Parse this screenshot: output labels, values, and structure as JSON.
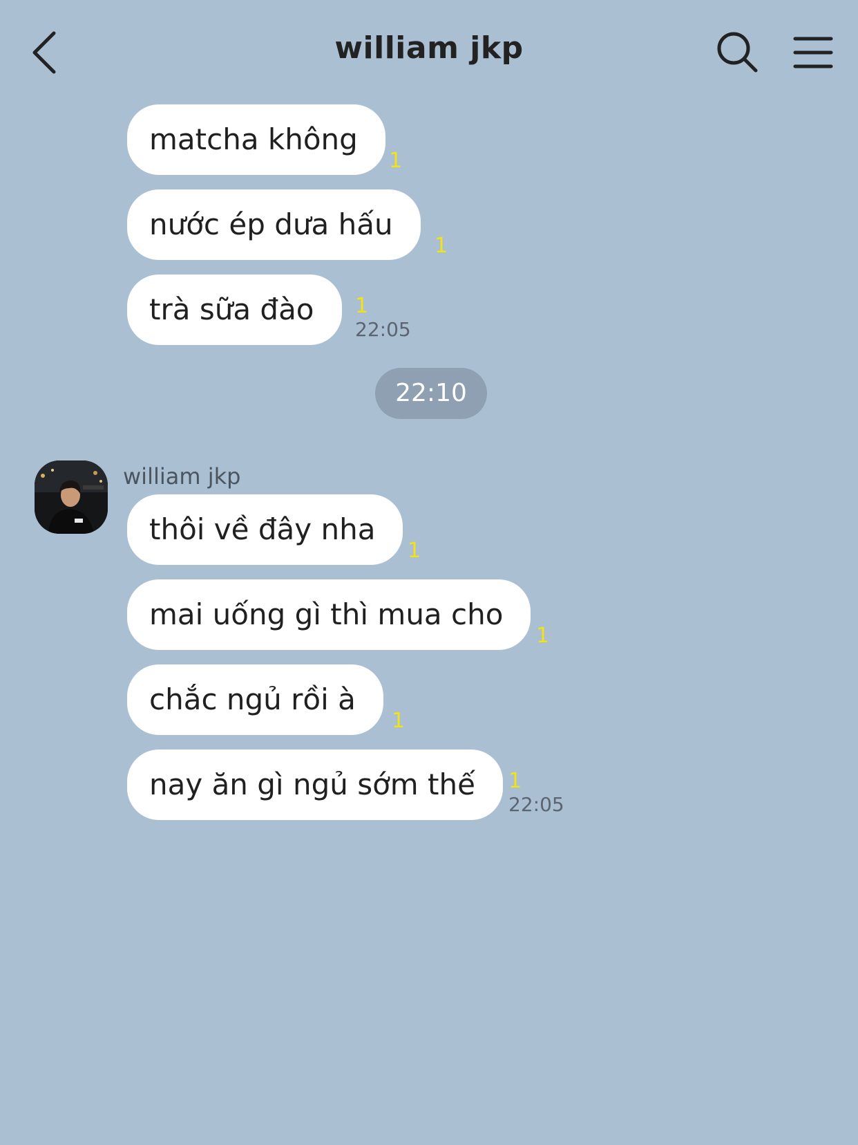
{
  "header": {
    "title": "william jkp"
  },
  "messages_group1": [
    {
      "text": "matcha không",
      "unread": "1",
      "time": ""
    },
    {
      "text": "nước ép dưa hấu",
      "unread": "1",
      "time": ""
    },
    {
      "text": "trà sữa đào",
      "unread": "1",
      "time": "22:05"
    }
  ],
  "divider_time": "22:10",
  "sender_name": "william jkp",
  "messages_group2": [
    {
      "text": "thôi về đây nha",
      "unread": "1",
      "time": ""
    },
    {
      "text": "mai uống gì thì mua cho",
      "unread": "1",
      "time": ""
    },
    {
      "text": "chắc ngủ rồi à",
      "unread": "1",
      "time": ""
    },
    {
      "text": "nay ăn gì ngủ sớm thế",
      "unread": "1",
      "time": "22:05"
    }
  ],
  "colors": {
    "background": "#abbfd3",
    "bubble": "#ffffff",
    "unread": "#f2e21a",
    "divider": "#8fa0b2"
  }
}
